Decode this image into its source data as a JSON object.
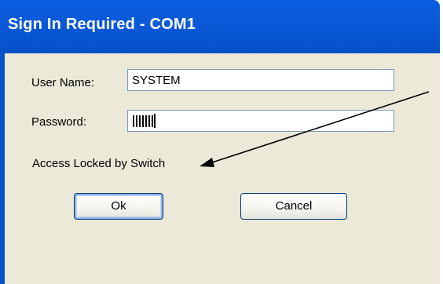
{
  "window": {
    "title": "Sign In Required - COM1"
  },
  "form": {
    "username_label": "User Name:",
    "username_value": "SYSTEM",
    "password_label": "Password:",
    "password_masked": true,
    "status_text": "Access Locked by Switch"
  },
  "buttons": {
    "ok_label": "Ok",
    "cancel_label": "Cancel"
  },
  "colors": {
    "titlebar": "#0a5fe0",
    "client_background": "#ece9d8",
    "textbox_border": "#7f9db9",
    "button_border": "#003c74"
  }
}
